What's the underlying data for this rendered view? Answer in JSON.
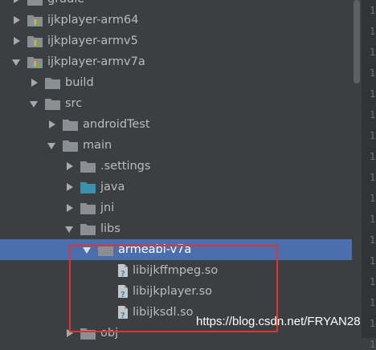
{
  "tree": {
    "items": [
      {
        "label": "gradle",
        "arrow": "collapsed",
        "icon": "folder-icon",
        "level": 0
      },
      {
        "label": "ijkplayer-arm64",
        "arrow": "collapsed",
        "icon": "module-icon",
        "level": 0
      },
      {
        "label": "ijkplayer-armv5",
        "arrow": "collapsed",
        "icon": "module-icon",
        "level": 0
      },
      {
        "label": "ijkplayer-armv7a",
        "arrow": "expanded",
        "icon": "module-icon",
        "level": 0
      },
      {
        "label": "build",
        "arrow": "collapsed",
        "icon": "folder-icon",
        "level": 1
      },
      {
        "label": "src",
        "arrow": "expanded",
        "icon": "folder-icon",
        "level": 1
      },
      {
        "label": "androidTest",
        "arrow": "collapsed",
        "icon": "folder-icon",
        "level": 2
      },
      {
        "label": "main",
        "arrow": "expanded",
        "icon": "folder-icon",
        "level": 2
      },
      {
        "label": ".settings",
        "arrow": "collapsed",
        "icon": "folder-icon",
        "level": 3
      },
      {
        "label": "java",
        "arrow": "collapsed",
        "icon": "source-folder-icon",
        "level": 3
      },
      {
        "label": "jni",
        "arrow": "collapsed",
        "icon": "folder-icon",
        "level": 3
      },
      {
        "label": "libs",
        "arrow": "expanded",
        "icon": "folder-icon",
        "level": 3
      },
      {
        "label": "armeabi-v7a",
        "arrow": "expanded",
        "icon": "folder-icon",
        "level": 4,
        "selected": true
      },
      {
        "label": "libijkffmpeg.so",
        "arrow": "none",
        "icon": "unknown-file-icon",
        "level": 5
      },
      {
        "label": "libijkplayer.so",
        "arrow": "none",
        "icon": "unknown-file-icon",
        "level": 5
      },
      {
        "label": "libijksdl.so",
        "arrow": "none",
        "icon": "unknown-file-icon",
        "level": 5
      },
      {
        "label": "obj",
        "arrow": "collapsed",
        "icon": "folder-icon",
        "level": 3
      }
    ]
  },
  "gutter": {
    "line_label": "1"
  },
  "watermark": {
    "text": "https://blog.csdn.net/FRYAN28"
  },
  "colors": {
    "background": "#3c3f41",
    "selection": "#4b6eaf",
    "folder": "#8a8f94",
    "source_folder": "#3d8fb0",
    "highlight": "#e0352f",
    "text": "#bbbbbb"
  }
}
